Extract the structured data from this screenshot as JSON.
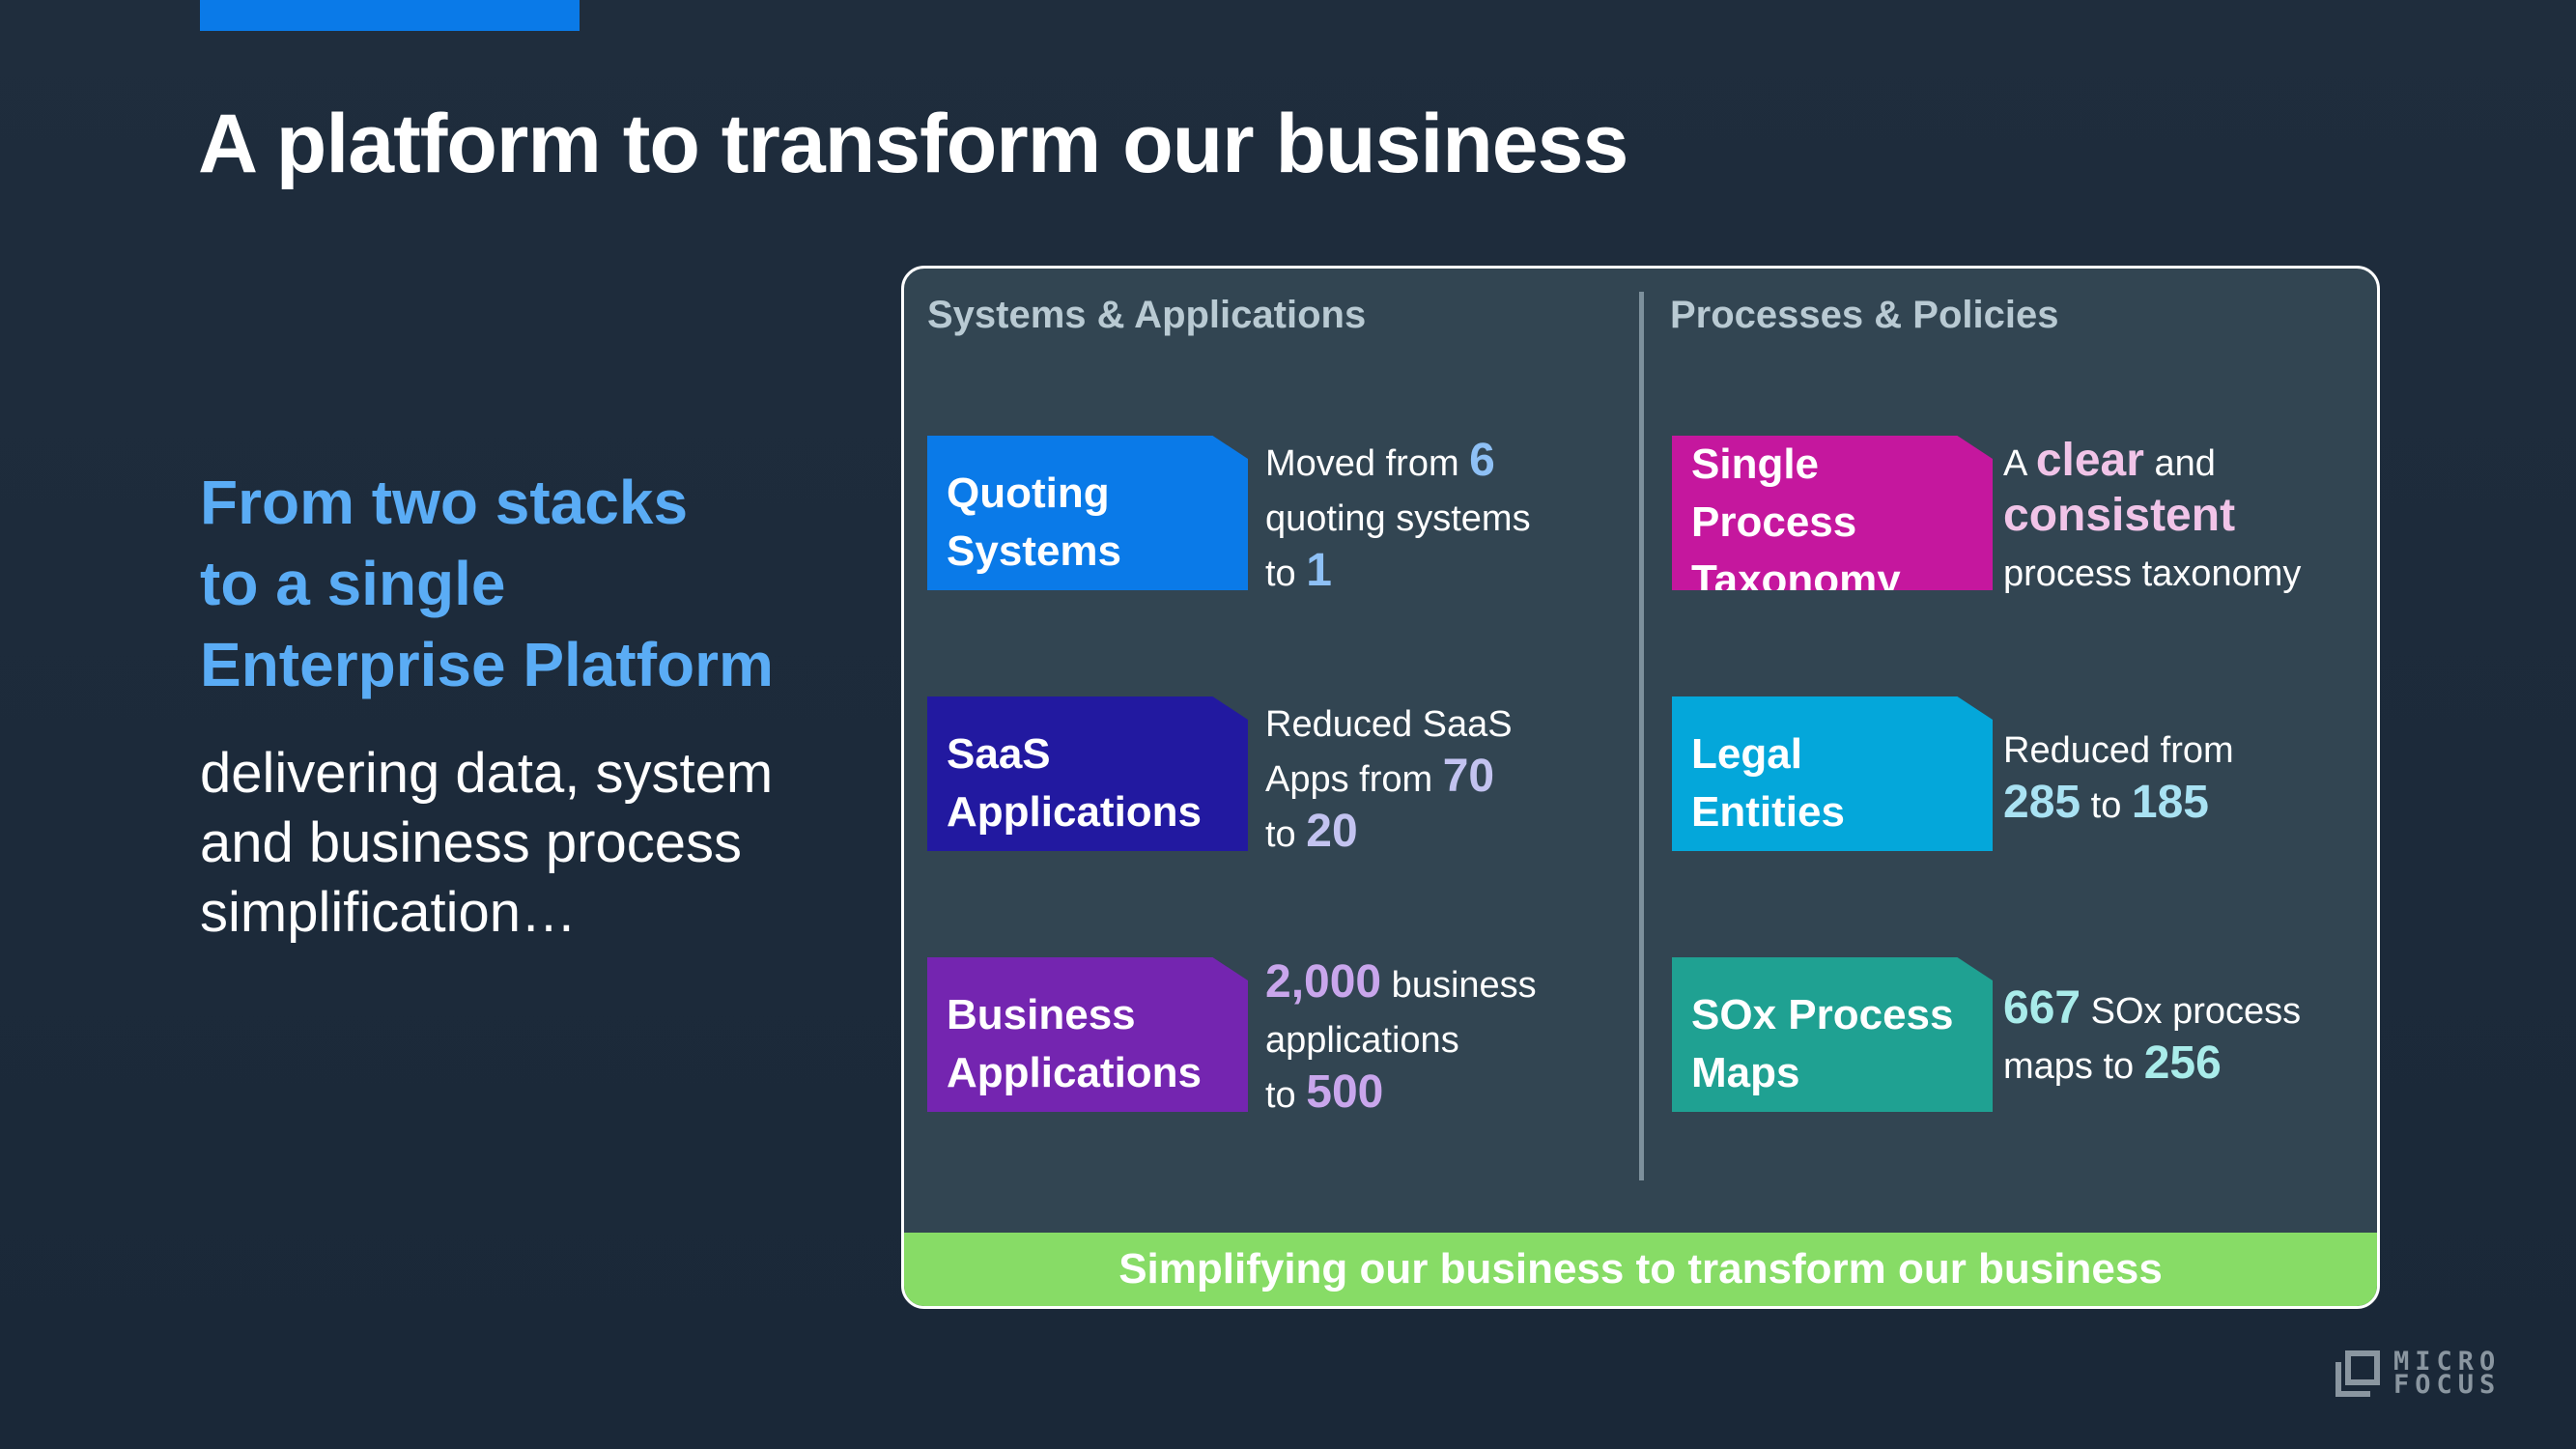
{
  "slide": {
    "title": "A platform to transform our business",
    "headline_lines": [
      "From two stacks",
      "to a single",
      "Enterprise Platform"
    ],
    "subtext_lines": [
      "delivering data, system",
      "and business process",
      "simplification…"
    ]
  },
  "colors": {
    "accent_bar": "#0a7ae8",
    "headline": "#5aacf5",
    "panel_bg": "#324552",
    "footer_bar": "#87dc66"
  },
  "panel": {
    "left_header": "Systems & Applications",
    "right_header": "Processes & Policies",
    "footer": "Simplifying our business to transform our business",
    "left_tiles": [
      {
        "label_lines": [
          "Quoting",
          "Systems"
        ],
        "color": "#0a7ae8",
        "num_color": "#8ec0f5",
        "desc": [
          [
            "Moved from ",
            "6"
          ],
          [
            "quoting systems",
            ""
          ],
          [
            "to ",
            "1"
          ]
        ]
      },
      {
        "label_lines": [
          "SaaS",
          "Applications"
        ],
        "color": "#2219a0",
        "num_color": "#c3c3f0",
        "desc": [
          [
            "Reduced SaaS",
            ""
          ],
          [
            "Apps from ",
            "70"
          ],
          [
            "to ",
            "20"
          ]
        ]
      },
      {
        "label_lines": [
          "Business",
          "Applications"
        ],
        "color": "#7425b0",
        "num_color": "#c9a6ec",
        "desc": [
          [
            "",
            "2,000",
            " business"
          ],
          [
            "applications",
            ""
          ],
          [
            "to ",
            "500"
          ]
        ]
      }
    ],
    "right_tiles": [
      {
        "label_lines": [
          "Single Process",
          "Taxonomy"
        ],
        "color": "#c5179e",
        "num_color": "#f1c4e8",
        "desc": [
          [
            " A ",
            "clear",
            " and"
          ],
          [
            "",
            "consistent"
          ],
          [
            "process taxonomy",
            ""
          ]
        ]
      },
      {
        "label_lines": [
          "Legal",
          "Entities"
        ],
        "color": "#04a7da",
        "num_color": "#a9e2f3",
        "desc": [
          [
            "Reduced from",
            ""
          ],
          [
            "",
            "285",
            " to ",
            "185"
          ]
        ]
      },
      {
        "label_lines": [
          "SOx Process",
          "Maps"
        ],
        "color": "#1fa192",
        "num_color": "#a9ecea",
        "desc": [
          [
            "",
            "667",
            " SOx process"
          ],
          [
            "maps to ",
            "256"
          ]
        ]
      }
    ]
  },
  "logo": {
    "line1": "MICRO",
    "line2": "FOCUS"
  }
}
